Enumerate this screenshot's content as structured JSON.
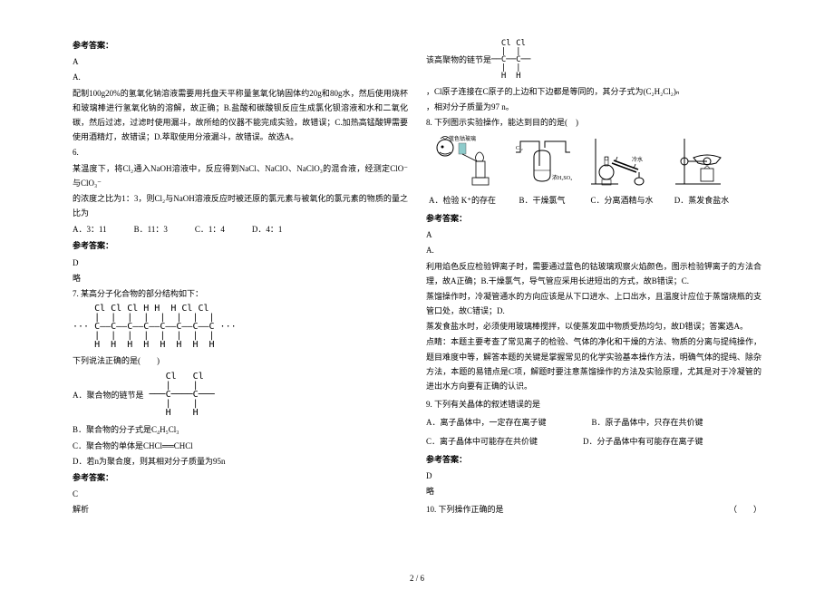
{
  "left": {
    "ans_title": "参考答案：",
    "ans5": "A",
    "ans5b": "A.",
    "q5_expl": "配制100g20%的氢氧化钠溶液需要用托盘天平称量氢氧化钠固体约20g和80g水，然后使用烧杯和玻璃棒进行氢氧化钠的溶解，故正确；B.盐酸和碳酸钡反应生成氯化钡溶液和水和二氧化碳，然后过滤，过滤时使用漏斗，故所给的仪器不能完成实验，故错误；C.加热高锰酸钾需要使用酒精灯，故错误；D.萃取使用分液漏斗，故错误。故选A。",
    "q6_num": "6.",
    "q6_text1": "某温度下，将Cl₂通入NaOH溶液中，反应得到NaCl、NaClO、NaClO₃的混合液，经测定ClO⁻与ClO₃⁻",
    "q6_text2": "的浓度之比为1：3，则Cl₂与NaOH溶液反应时被还原的氯元素与被氧化的氯元素的物质的量之比为",
    "q6_optA": "A．3：11",
    "q6_optB": "B．11：3",
    "q6_optC": "C．1：4",
    "q6_optD": "D．4：1",
    "ans6": "D",
    "ans6_note": "略",
    "q7_num": "7. 某高分子化合物的部分结构如下：",
    "q7_struct_row1": "    Cl Cl Cl H H  H Cl Cl",
    "q7_struct_row2": "    |  |  |  |  |  |  |  |",
    "q7_struct_row3": "··· C——C——C——C——C——C——C——C ···",
    "q7_struct_row4": "    |  |  |  |  |  |  |  |",
    "q7_struct_row5": "    H  H  H  H  H  H  H  H",
    "q7_ask": "下列说法正确的是(　　)",
    "q7_small_r1": "    Cl   Cl",
    "q7_small_r2": "    |    |",
    "q7_small_r3": " ───C────C───",
    "q7_small_r4": "    |    |",
    "q7_small_r5": "    H    H",
    "q7_optA": "A．聚合物的链节是",
    "q7_optB": "B．聚合物的分子式是C₄H₅Cl₃",
    "q7_optC": "C．聚合物的单体是CHCl══CHCl",
    "q7_optD": "D．若n为聚合度，则其相对分子质量为95n",
    "ans7": "C",
    "ans7_note": "解析"
  },
  "right": {
    "r_struct_r1": "  Cl Cl",
    "r_struct_r2": "  |  |",
    "r_struct_r3": "──C──C──",
    "r_struct_r4": "  |  |",
    "r_struct_r5": "  H  H",
    "r_line1a": "该高聚物的链节是",
    "r_line1b": "，Cl原子连接在C原子的上边和下边都是等同的，其分子式为(C₂H₂Cl₂)ₙ",
    "r_line2": "，相对分子质量为97 n。",
    "q8": "8. 下列图示实验操作，能达到目的的是(　)",
    "exp_label_blue": "蓝色钴玻璃",
    "exp_label_h2so4": "浓H₂SO₄",
    "exp_label_cl2": "Cl₂",
    "exp_label_water": "冷水",
    "exp_A": "A．检验 K⁺的存在",
    "exp_B": "B．干燥氯气",
    "exp_C": "C．分离酒精与水",
    "exp_D": "D．蒸发食盐水",
    "ans8_title": "参考答案：",
    "ans8": "A",
    "ans8b": "A.",
    "expl8_1": "利用焰色反应检验钾离子时，需要通过蓝色的钴玻璃观察火焰颜色，图示检验钾离子的方法合理，故A正确；B.干燥氯气，导气管应采用长进短出的方式，故B错误；C.",
    "expl8_2": "蒸馏操作时，冷凝管通水的方向应该是从下口进水、上口出水，且温度计应位于蒸馏烧瓶的支管口处，故C错误；D.",
    "expl8_3": "蒸发食盐水时，必须使用玻璃棒搅拌，以使蒸发皿中物质受热均匀，故D错误；答案选A。",
    "expl8_4": "点睛：本题主要考查了常见离子的检验、气体的净化和干燥的方法、物质的分离与提纯操作，题目难度中等，解答本题的关键是掌握常见的化学实验基本操作方法，明确气体的提纯、除杂方法，本题的易错点是C项，解题时要注意蒸馏操作的方法及实验原理，尤其是对于冷凝管的进出水方向要有正确的认识。",
    "q9": "9. 下列有关晶体的叙述错误的是",
    "q9_A": "A．离子晶体中，一定存在离子键",
    "q9_B": "B．原子晶体中，只存在共价键",
    "q9_C": "C．离子晶体中可能存在共价键",
    "q9_D": "D．分子晶体中有可能存在离子键",
    "ans9_title": "参考答案：",
    "ans9": "D",
    "ans9_note": "略",
    "q10": "10. 下列操作正确的是",
    "q10_paren": "（　　）"
  },
  "footer": "2 / 6"
}
